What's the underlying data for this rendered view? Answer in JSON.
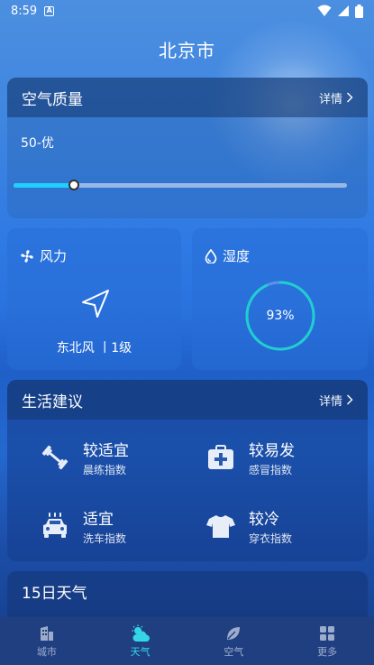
{
  "status": {
    "time": "8:59",
    "notif": "A"
  },
  "title": "北京市",
  "air": {
    "title": "空气质量",
    "detail": "详情",
    "value": "50-优",
    "level_fraction": 0.18
  },
  "wind": {
    "title": "风力",
    "text": "东北风 丨1级"
  },
  "humidity": {
    "title": "湿度",
    "value": "93%",
    "fraction": 0.93
  },
  "life": {
    "title": "生活建议",
    "detail": "详情",
    "items": [
      {
        "main": "较适宜",
        "sub": "晨练指数",
        "icon": "dumbbell-icon"
      },
      {
        "main": "较易发",
        "sub": "感冒指数",
        "icon": "medical-kit-icon"
      },
      {
        "main": "适宜",
        "sub": "洗车指数",
        "icon": "car-wash-icon"
      },
      {
        "main": "较冷",
        "sub": "穿衣指数",
        "icon": "shirt-icon"
      }
    ]
  },
  "forecast": {
    "title": "15日天气"
  },
  "nav": [
    {
      "label": "城市",
      "icon": "building-icon"
    },
    {
      "label": "天气",
      "icon": "weather-icon"
    },
    {
      "label": "空气",
      "icon": "leaf-icon"
    },
    {
      "label": "更多",
      "icon": "grid-icon"
    }
  ],
  "colors": {
    "accent": "#34d6e6",
    "slider": "#1ed0ff",
    "ring": "#1ecfd0"
  }
}
